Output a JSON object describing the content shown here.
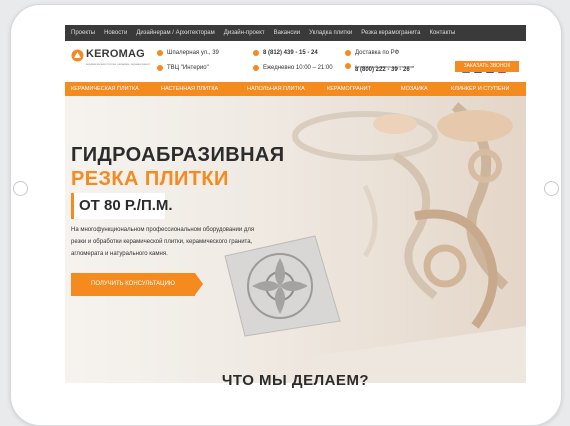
{
  "topnav": {
    "items": [
      "Проекты",
      "Новости",
      "Дизайнерам / Архитекторам",
      "Дизайн-проект",
      "Вакансии",
      "Укладка плитки",
      "Резка керамогранита",
      "Контакты"
    ]
  },
  "header": {
    "logo": {
      "word": "KEROMAG",
      "tagline": "керамическая плитка, мозаика, керамогранит"
    },
    "address1": "Шпалерная ул., 39",
    "address2": "ТВЦ \"Интерио\"",
    "phone1": "8 (812) 439 - 15 - 24",
    "hours": "Ежедневно 10:00 – 21:00",
    "delivery": "Доставка по РФ",
    "free_call_note": "Бесплатный звонок из регионов",
    "phone2": "8 (800) 222 - 39 - 26",
    "callback_label": "ЗАКАЗАТЬ ЗВОНОК",
    "socials": [
      "vk-icon",
      "facebook-icon",
      "youtube-icon",
      "instagram-icon"
    ]
  },
  "catnav": {
    "items": [
      "КЕРАМИЧЕСКАЯ ПЛИТКА",
      "НАСТЕННАЯ ПЛИТКА",
      "НАПОЛЬНАЯ ПЛИТКА",
      "КЕРАМОГРАНИТ",
      "МОЗАИКА",
      "КЛИНКЕР И СТУПЕНИ"
    ]
  },
  "hero": {
    "title_line1": "ГИДРОАБРАЗИВНАЯ",
    "title_line2": "РЕЗКА ПЛИТКИ",
    "price": "ОТ 80 Р./П.М.",
    "desc": "На многофункциональном профессиональном оборудовании для резки и обработки керамической плитки, керамического гранита, агломерата и натурального камня.",
    "cta_label": "ПОЛУЧИТЬ КОНСУЛЬТАЦИЮ"
  },
  "section": {
    "title": "ЧТО МЫ ДЕЛАЕМ?"
  },
  "colors": {
    "accent": "#f58a1f",
    "topbar": "#3a3a3a",
    "text": "#2c2c2c"
  }
}
